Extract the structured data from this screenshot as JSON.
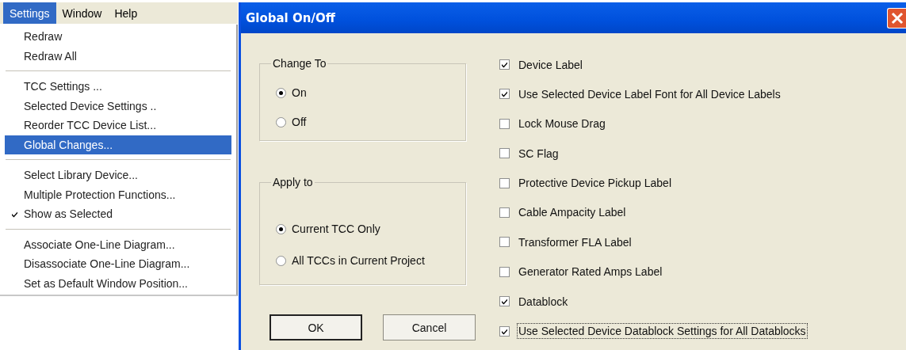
{
  "menu_bar": [
    {
      "label": "Settings",
      "selected": true
    },
    {
      "label": "Window",
      "selected": false
    },
    {
      "label": "Help",
      "selected": false
    }
  ],
  "menu": {
    "groups": [
      {
        "items": [
          {
            "label": "Redraw",
            "checked": false,
            "selected": false
          },
          {
            "label": "Redraw All",
            "checked": false,
            "selected": false
          }
        ]
      },
      {
        "items": [
          {
            "label": "TCC Settings ...",
            "checked": false,
            "selected": false
          },
          {
            "label": "Selected Device Settings ..",
            "checked": false,
            "selected": false
          },
          {
            "label": "Reorder TCC Device List...",
            "checked": false,
            "selected": false
          },
          {
            "label": "Global Changes...",
            "checked": false,
            "selected": true
          }
        ]
      },
      {
        "items": [
          {
            "label": "Select Library Device...",
            "checked": false,
            "selected": false
          },
          {
            "label": "Multiple Protection Functions...",
            "checked": false,
            "selected": false
          },
          {
            "label": "Show as Selected",
            "checked": true,
            "selected": false
          }
        ]
      },
      {
        "items": [
          {
            "label": "Associate One-Line Diagram...",
            "checked": false,
            "selected": false
          },
          {
            "label": "Disassociate One-Line Diagram...",
            "checked": false,
            "selected": false
          },
          {
            "label": "Set as Default Window Position...",
            "checked": false,
            "selected": false
          }
        ]
      }
    ]
  },
  "dialog": {
    "title": "Global On/Off",
    "change_to": {
      "label": "Change To",
      "options": [
        {
          "label": "On",
          "selected": true
        },
        {
          "label": "Off",
          "selected": false
        }
      ]
    },
    "apply_to": {
      "label": "Apply to",
      "options": [
        {
          "label": "Current TCC Only",
          "selected": true
        },
        {
          "label": "All TCCs in Current Project",
          "selected": false
        }
      ]
    },
    "checkboxes": [
      {
        "label": "Device Label",
        "checked": true,
        "focused": false
      },
      {
        "label": "Use Selected Device Label Font for All Device Labels",
        "checked": true,
        "focused": false
      },
      {
        "label": "Lock Mouse Drag",
        "checked": false,
        "focused": false
      },
      {
        "label": "SC Flag",
        "checked": false,
        "focused": false
      },
      {
        "label": "Protective Device Pickup Label",
        "checked": false,
        "focused": false
      },
      {
        "label": "Cable Ampacity Label",
        "checked": false,
        "focused": false
      },
      {
        "label": "Transformer FLA Label",
        "checked": false,
        "focused": false
      },
      {
        "label": "Generator Rated Amps Label",
        "checked": false,
        "focused": false
      },
      {
        "label": "Datablock",
        "checked": true,
        "focused": false
      },
      {
        "label": "Use Selected Device Datablock Settings for All Datablocks",
        "checked": true,
        "focused": true
      }
    ],
    "buttons": [
      {
        "label": "OK",
        "default": true
      },
      {
        "label": "Cancel",
        "default": false
      }
    ]
  }
}
